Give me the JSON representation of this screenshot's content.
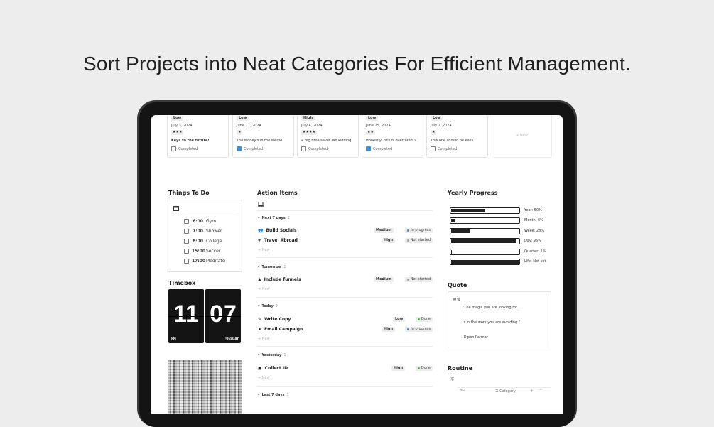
{
  "headline": "Sort Projects into Neat Categories For Efficient Management.",
  "gallery": [
    {
      "priority": "Low",
      "date": "July 3, 2024",
      "stars": "★★★",
      "note": "Keys to the future!",
      "completed": false,
      "completed_label": "Completed"
    },
    {
      "priority": "Low",
      "date": "June 21, 2024",
      "stars": "★",
      "note": "The Money's in the Memo.",
      "completed": true,
      "completed_label": "Completed"
    },
    {
      "priority": "High",
      "date": "July 4, 2024",
      "stars": "★★★★",
      "note": "A big time saver. No kidding.",
      "completed": false,
      "completed_label": "Completed"
    },
    {
      "priority": "Low",
      "date": "June 25, 2024",
      "stars": "★★",
      "note": "Honestly, this is overrated :(",
      "completed": true,
      "completed_label": "Completed"
    },
    {
      "priority": "Low",
      "date": "July 2, 2024",
      "stars": "★",
      "note": "This one should be easy.",
      "completed": false,
      "completed_label": "Completed"
    }
  ],
  "new_label": "+ New",
  "things_to_do": {
    "title": "Things To Do",
    "items": [
      {
        "time": "6:00",
        "task": "Gym"
      },
      {
        "time": "7:00",
        "task": "Shower"
      },
      {
        "time": "8:00",
        "task": "College"
      },
      {
        "time": "15:00",
        "task": "Soccer"
      },
      {
        "time": "17:00",
        "task": "Meditate"
      }
    ]
  },
  "timebox": {
    "title": "Timebox",
    "hour": "11",
    "minute": "07",
    "ampm": "PM",
    "day": "TUESDAY"
  },
  "action_items": {
    "title": "Action Items",
    "new": "+ New",
    "groups": [
      {
        "label": "Next 7 days",
        "count": "2",
        "items": [
          {
            "title": "Build Socials",
            "priority": "Medium",
            "status": "In progress"
          },
          {
            "title": "Travel Abroad",
            "priority": "High",
            "status": "Not started"
          }
        ]
      },
      {
        "label": "Tomorrow",
        "count": "1",
        "items": [
          {
            "title": "Include funnels",
            "priority": "Medium",
            "status": "Not started"
          }
        ]
      },
      {
        "label": "Today",
        "count": "2",
        "items": [
          {
            "title": "Write Copy",
            "priority": "Low",
            "status": "Done"
          },
          {
            "title": "Email Campaign",
            "priority": "High",
            "status": "In progress"
          }
        ]
      },
      {
        "label": "Yesterday",
        "count": "1",
        "items": [
          {
            "title": "Collect ID",
            "priority": "High",
            "status": "Done"
          }
        ]
      },
      {
        "label": "Last 7 days",
        "count": "1",
        "items": []
      }
    ]
  },
  "yearly_progress": {
    "title": "Yearly Progress",
    "bars": [
      {
        "label": "Year: 50%",
        "fraction": 0.5
      },
      {
        "label": "Month: 6%",
        "fraction": 0.06
      },
      {
        "label": "Week: 28%",
        "fraction": 0.28
      },
      {
        "label": "Day: 96%",
        "fraction": 0.96
      },
      {
        "label": "Quarter: 1%",
        "fraction": 0.01
      },
      {
        "label": "Life: Not set",
        "fraction": 1.0
      }
    ]
  },
  "quote": {
    "title": "Quote",
    "line1": "\"The magic you are looking for...",
    "line2": "Is in the work you are avoiding.\"",
    "author": "-Dipen Parmar"
  },
  "routine": {
    "title": "Routine",
    "col_category": "Category"
  },
  "colors": {
    "blue": "#3a8fd9",
    "green": "#4caf50",
    "gray": "#9e9e9e",
    "dark": "#222222"
  }
}
